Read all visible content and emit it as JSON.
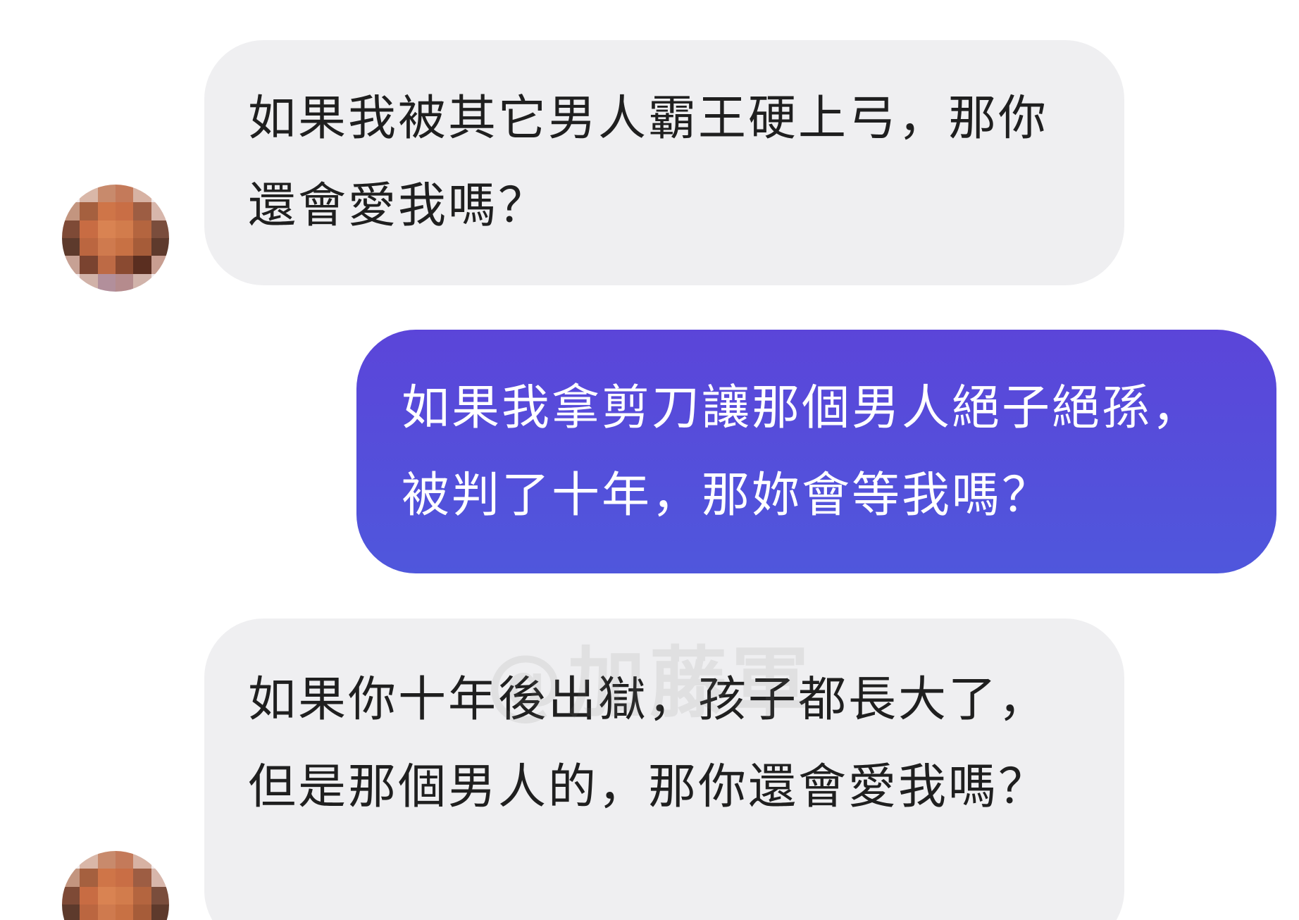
{
  "conversation": {
    "messages": [
      {
        "direction": "incoming",
        "text": "如果我被其它男人霸王硬上弓，那你還會愛我嗎？"
      },
      {
        "direction": "outgoing",
        "text": "如果我拿剪刀讓那個男人絕子絕孫，被判了十年，那妳會等我嗎？"
      },
      {
        "direction": "incoming",
        "text": "如果你十年後出獄，孩子都長大了，但是那個男人的，那你還會愛我嗎？"
      }
    ],
    "watermark": "@加藤軍"
  },
  "colors": {
    "incoming_bubble": "#efeff1",
    "outgoing_bubble": "#5149db",
    "incoming_text": "#1f1f1f",
    "outgoing_text": "#ffffff"
  },
  "avatar_style": "pixelated-blurred-face"
}
